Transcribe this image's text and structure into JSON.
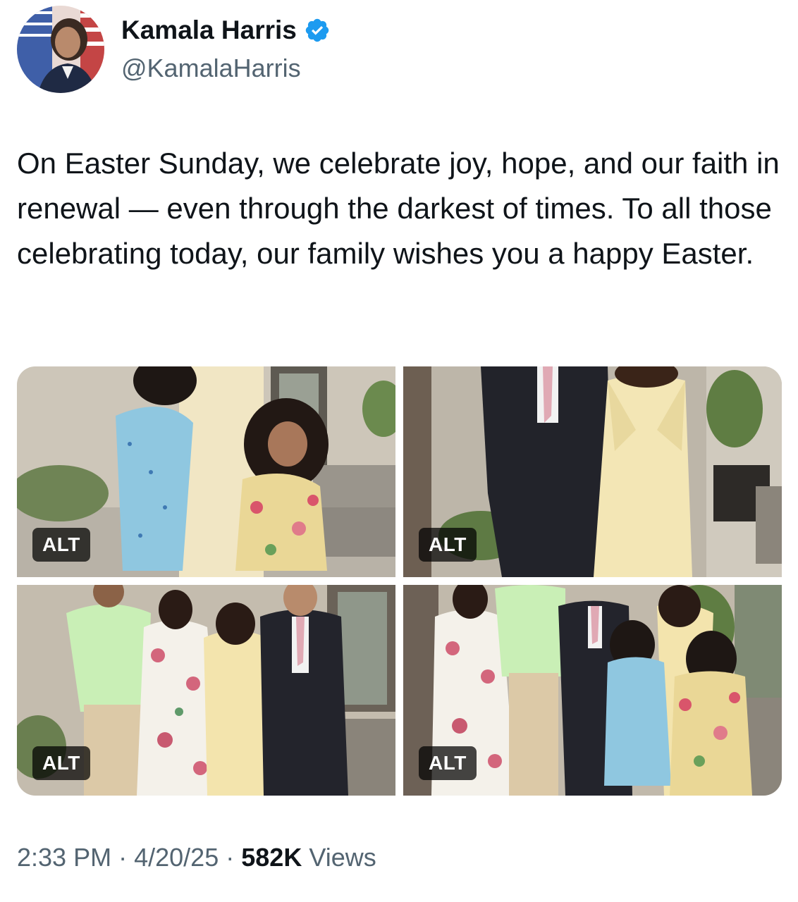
{
  "author": {
    "name": "Kamala Harris",
    "handle": "@KamalaHarris",
    "verified": true,
    "verified_color": "#1d9bf0"
  },
  "tweet": {
    "text": "On Easter Sunday, we celebrate joy, hope, and our faith in renewal — even through the darkest of times. To all those celebrating today, our family wishes you a happy Easter."
  },
  "media": {
    "photos": [
      {
        "alt_label": "ALT"
      },
      {
        "alt_label": "ALT"
      },
      {
        "alt_label": "ALT"
      },
      {
        "alt_label": "ALT"
      }
    ]
  },
  "meta": {
    "time": "2:33 PM",
    "separator": "·",
    "date": "4/20/25",
    "views_count": "582K",
    "views_label": "Views"
  },
  "colors": {
    "text_primary": "#0f1419",
    "text_secondary": "#536471"
  }
}
